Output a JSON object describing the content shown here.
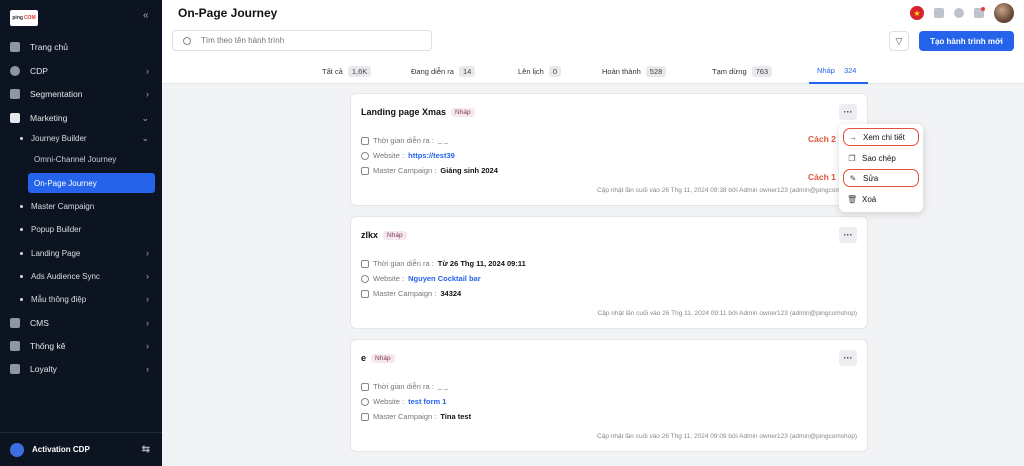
{
  "sidebar": {
    "logo_text": "ping",
    "logo_accent": "COM",
    "items": [
      {
        "label": "Trang chủ"
      },
      {
        "label": "CDP"
      },
      {
        "label": "Segmentation"
      },
      {
        "label": "Marketing"
      }
    ],
    "marketing_sub": [
      {
        "label": "Journey Builder"
      },
      {
        "label": "Master Campaign"
      },
      {
        "label": "Popup Builder"
      },
      {
        "label": "Landing Page"
      },
      {
        "label": "Ads Audience Sync"
      },
      {
        "label": "Mẫu thông điệp"
      }
    ],
    "journey_leaves": [
      {
        "label": "Omni-Channel Journey"
      },
      {
        "label": "On-Page Journey"
      }
    ],
    "items_after": [
      {
        "label": "CMS"
      },
      {
        "label": "Thống kê"
      },
      {
        "label": "Loyalty"
      }
    ],
    "bottom_label": "Activation CDP"
  },
  "header": {
    "title": "On-Page Journey"
  },
  "search": {
    "placeholder": "Tìm theo tên hành trình"
  },
  "toolbar": {
    "create_label": "Tạo hành trình mới"
  },
  "tabs": [
    {
      "label": "Tất cả",
      "count": "1,6K"
    },
    {
      "label": "Đang diễn ra",
      "count": "14"
    },
    {
      "label": "Lên lịch",
      "count": "0"
    },
    {
      "label": "Hoàn thành",
      "count": "528"
    },
    {
      "label": "Tạm dừng",
      "count": "763"
    },
    {
      "label": "Nháp",
      "count": "324"
    }
  ],
  "cards": [
    {
      "title": "Landing page Xmas",
      "badge": "Nháp",
      "time_label": "Thời gian diễn ra :",
      "time_value": "_ _",
      "website_label": "Website :",
      "website_value": "https://test39",
      "master_label": "Master Campaign :",
      "master_value": "Giáng sinh 2024",
      "updated": "Cập nhật lần cuối vào 26 Thg 11, 2024 09:38 bởi Admin owner123 (admin@pingcomshop)"
    },
    {
      "title": "zlkx",
      "badge": "Nháp",
      "time_label": "Thời gian diễn ra :",
      "time_value": "Từ 26 Thg 11, 2024 09:11",
      "website_label": "Website :",
      "website_value": "Nguyen Cocktail bar",
      "master_label": "Master Campaign :",
      "master_value": "34324",
      "updated": "Cập nhật lần cuối vào 26 Thg 11, 2024 09:11 bởi Admin owner123 (admin@pingcomshop)"
    },
    {
      "title": "e",
      "badge": "Nháp",
      "time_label": "Thời gian diễn ra :",
      "time_value": "_ _",
      "website_label": "Website :",
      "website_value": "test form 1",
      "master_label": "Master Campaign :",
      "master_value": "Tina test",
      "updated": "Cập nhật lần cuối vào 26 Thg 11, 2024 09:09 bởi Admin owner123 (admin@pingcomshop)"
    }
  ],
  "menu": [
    {
      "label": "Xem chi tiết",
      "icon": "arrow-right-icon"
    },
    {
      "label": "Sao chép",
      "icon": "copy-icon"
    },
    {
      "label": "Sửa",
      "icon": "edit-icon"
    },
    {
      "label": "Xoá",
      "icon": "trash-icon"
    }
  ],
  "annotations": {
    "cach2": "Cách 2",
    "cach1": "Cách 1"
  },
  "colors": {
    "accent": "#2563eb",
    "sidebar_bg": "#0d1421",
    "annotation": "#e0533a"
  }
}
